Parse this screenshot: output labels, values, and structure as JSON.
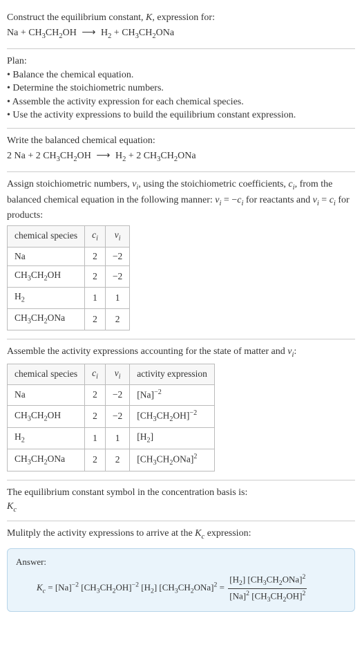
{
  "intro": {
    "line1_a": "Construct the equilibrium constant, ",
    "line1_b": ", expression for:",
    "eq_lhs1": "Na + CH",
    "eq_lhs2": "CH",
    "eq_lhs3": "OH",
    "arrow": "⟶",
    "eq_rhs1": " + CH",
    "eq_rhs2": "CH",
    "eq_rhs3": "ONa"
  },
  "plan": {
    "title": "Plan:",
    "b1": "• Balance the chemical equation.",
    "b2": "• Determine the stoichiometric numbers.",
    "b3": "• Assemble the activity expression for each chemical species.",
    "b4": "• Use the activity expressions to build the equilibrium constant expression."
  },
  "balanced": {
    "title": "Write the balanced chemical equation:",
    "lhs_a": "2 Na + 2 CH",
    "lhs_b": "CH",
    "lhs_c": "OH",
    "arrow": "⟶",
    "rhs_a": " + 2 CH",
    "rhs_b": "CH",
    "rhs_c": "ONa",
    "h2": "H"
  },
  "assign": {
    "text_a": "Assign stoichiometric numbers, ",
    "text_b": ", using the stoichiometric coefficients, ",
    "text_c": ", from the balanced chemical equation in the following manner: ",
    "text_d": " for reactants and ",
    "text_e": " for products:",
    "nu": "ν",
    "ci": "c",
    "eq1_a": " = −",
    "eq2_a": " = "
  },
  "table1": {
    "h1": "chemical species",
    "h2": "c",
    "h3": "ν",
    "r1": {
      "sp": "Na",
      "c": "2",
      "v": "−2"
    },
    "r2": {
      "sp_a": "CH",
      "sp_b": "CH",
      "sp_c": "OH",
      "c": "2",
      "v": "−2"
    },
    "r3": {
      "sp": "H",
      "c": "1",
      "v": "1"
    },
    "r4": {
      "sp_a": "CH",
      "sp_b": "CH",
      "sp_c": "ONa",
      "c": "2",
      "v": "2"
    }
  },
  "assemble": {
    "text_a": "Assemble the activity expressions accounting for the state of matter and ",
    "text_b": ":"
  },
  "table2": {
    "h1": "chemical species",
    "h2": "c",
    "h3": "ν",
    "h4": "activity expression",
    "r1": {
      "sp": "Na",
      "c": "2",
      "v": "−2",
      "ae_a": "[Na]",
      "ae_exp": "−2"
    },
    "r2": {
      "sp_a": "CH",
      "sp_b": "CH",
      "sp_c": "OH",
      "c": "2",
      "v": "−2",
      "ae_a": "[CH",
      "ae_b": "CH",
      "ae_c": "OH]",
      "ae_exp": "−2"
    },
    "r3": {
      "sp": "H",
      "c": "1",
      "v": "1",
      "ae_a": "[H",
      "ae_b": "]"
    },
    "r4": {
      "sp_a": "CH",
      "sp_b": "CH",
      "sp_c": "ONa",
      "c": "2",
      "v": "2",
      "ae_a": "[CH",
      "ae_b": "CH",
      "ae_c": "ONa]",
      "ae_exp": "2"
    }
  },
  "kcsym": {
    "text": "The equilibrium constant symbol in the concentration basis is:",
    "K": "K",
    "sub": "c"
  },
  "mult": {
    "text_a": "Mulitply the activity expressions to arrive at the ",
    "text_b": " expression:"
  },
  "answer": {
    "label": "Answer:",
    "K": "K",
    "Kc": "c",
    "eq": " = ",
    "t1": "[Na]",
    "e1": "−2",
    "t2a": " [CH",
    "t2b": "CH",
    "t2c": "OH]",
    "e2": "−2",
    "t3a": " [H",
    "t3b": "] ",
    "t4a": "[CH",
    "t4b": "CH",
    "t4c": "ONa]",
    "e4": "2",
    "eq2": " = ",
    "num_a": "[H",
    "num_b": "] [CH",
    "num_c": "CH",
    "num_d": "ONa]",
    "num_e": "2",
    "den_a": "[Na]",
    "den_e1": "2",
    "den_b": " [CH",
    "den_c": "CH",
    "den_d": "OH]",
    "den_e2": "2"
  }
}
